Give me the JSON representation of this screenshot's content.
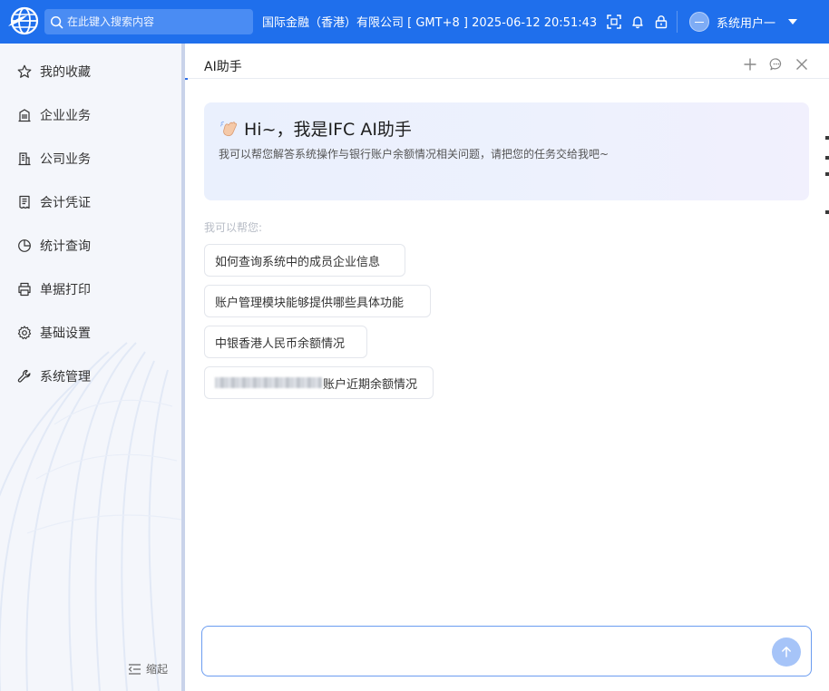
{
  "topbar": {
    "search_placeholder": "在此键入搜索内容",
    "company": "国际金融（香港）有限公司 [ GMT+8 ]  2025-06-12 20:51:43",
    "username": "系统用户一"
  },
  "sidebar": {
    "items": [
      {
        "label": "我的收藏",
        "icon": "star-icon"
      },
      {
        "label": "企业业务",
        "icon": "building-icon"
      },
      {
        "label": "公司业务",
        "icon": "office-building-icon"
      },
      {
        "label": "会计凭证",
        "icon": "receipt-icon"
      },
      {
        "label": "统计查询",
        "icon": "pie-chart-icon"
      },
      {
        "label": "单据打印",
        "icon": "printer-icon"
      },
      {
        "label": "基础设置",
        "icon": "gear-icon"
      },
      {
        "label": "系统管理",
        "icon": "wrench-icon"
      }
    ],
    "collapse_label": "缩起"
  },
  "panel": {
    "title": "AI助手",
    "welcome_title": "Hi~，我是IFC AI助手",
    "welcome_desc": "我可以帮您解答系统操作与银行账户余额情况相关问题，请把您的任务交给我吧~",
    "help_label": "我可以帮您:",
    "suggestions": [
      "如何查询系统中的成员企业信息",
      "账户管理模块能够提供哪些具体功能",
      "中银香港人民币余额情况",
      "账户近期余额情况"
    ]
  },
  "colors": {
    "topbar_bg": "#1f6fec",
    "accent": "#2f6fe8",
    "sidebar_bg": "#f4f6fb",
    "send_button": "#a6c4f8"
  }
}
